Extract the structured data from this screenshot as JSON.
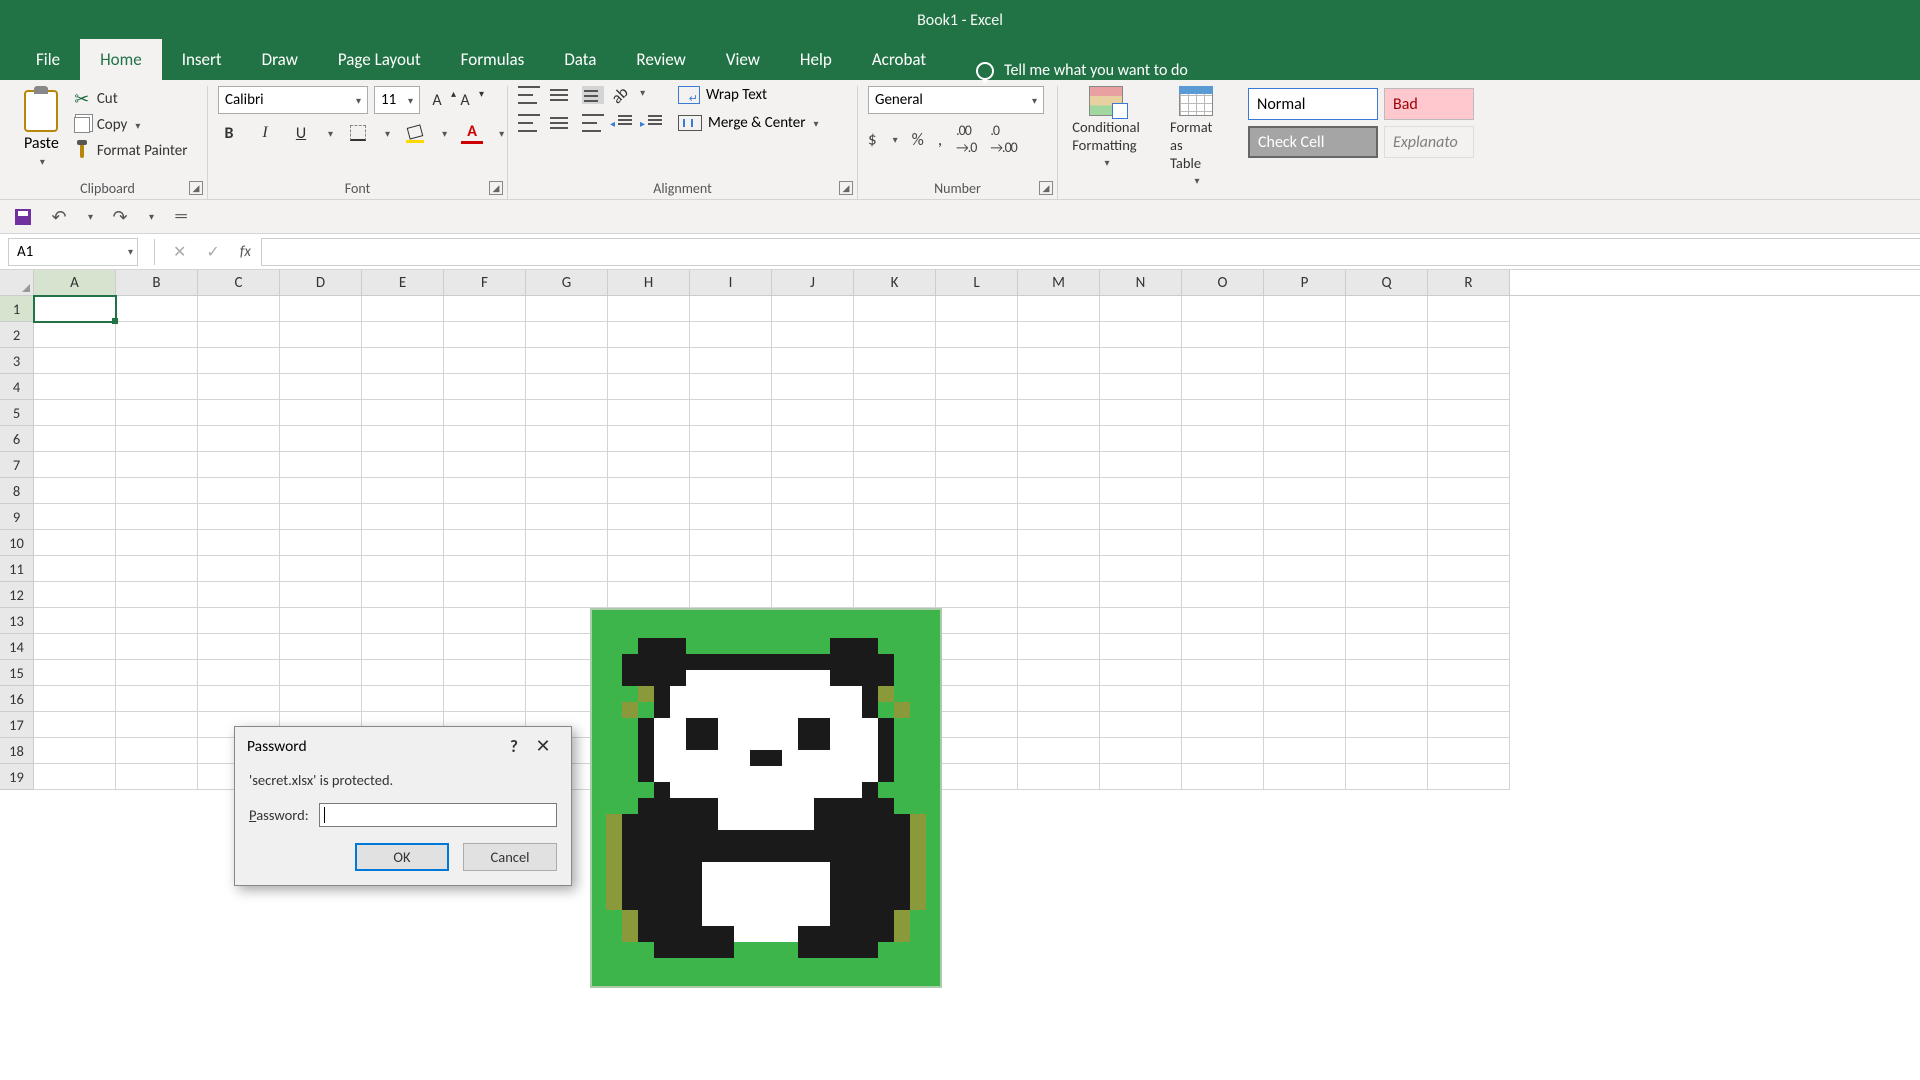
{
  "title": "Book1 - Excel",
  "tabs": [
    "File",
    "Home",
    "Insert",
    "Draw",
    "Page Layout",
    "Formulas",
    "Data",
    "Review",
    "View",
    "Help",
    "Acrobat"
  ],
  "active_tab": "Home",
  "tell_me": "Tell me what you want to do",
  "ribbon": {
    "clipboard": {
      "label": "Clipboard",
      "paste": "Paste",
      "cut": "Cut",
      "copy": "Copy",
      "format_painter": "Format Painter"
    },
    "font": {
      "label": "Font",
      "name": "Calibri",
      "size": "11"
    },
    "alignment": {
      "label": "Alignment",
      "wrap": "Wrap Text",
      "merge": "Merge & Center"
    },
    "number": {
      "label": "Number",
      "format": "General"
    },
    "styles": {
      "conditional": "Conditional Formatting",
      "format_as_table": "Format as Table",
      "gallery": {
        "normal": "Normal",
        "bad": "Bad",
        "check": "Check Cell",
        "explanatory": "Explanato"
      }
    }
  },
  "namebox": "A1",
  "columns": [
    "A",
    "B",
    "C",
    "D",
    "E",
    "F",
    "G",
    "H",
    "I",
    "J",
    "K",
    "L",
    "M",
    "N",
    "O",
    "P",
    "Q",
    "R"
  ],
  "rows": 19,
  "dialog": {
    "title": "Password",
    "message": "'secret.xlsx' is protected.",
    "label_pre": "P",
    "label_post": "assword:",
    "ok": "OK",
    "cancel": "Cancel"
  }
}
